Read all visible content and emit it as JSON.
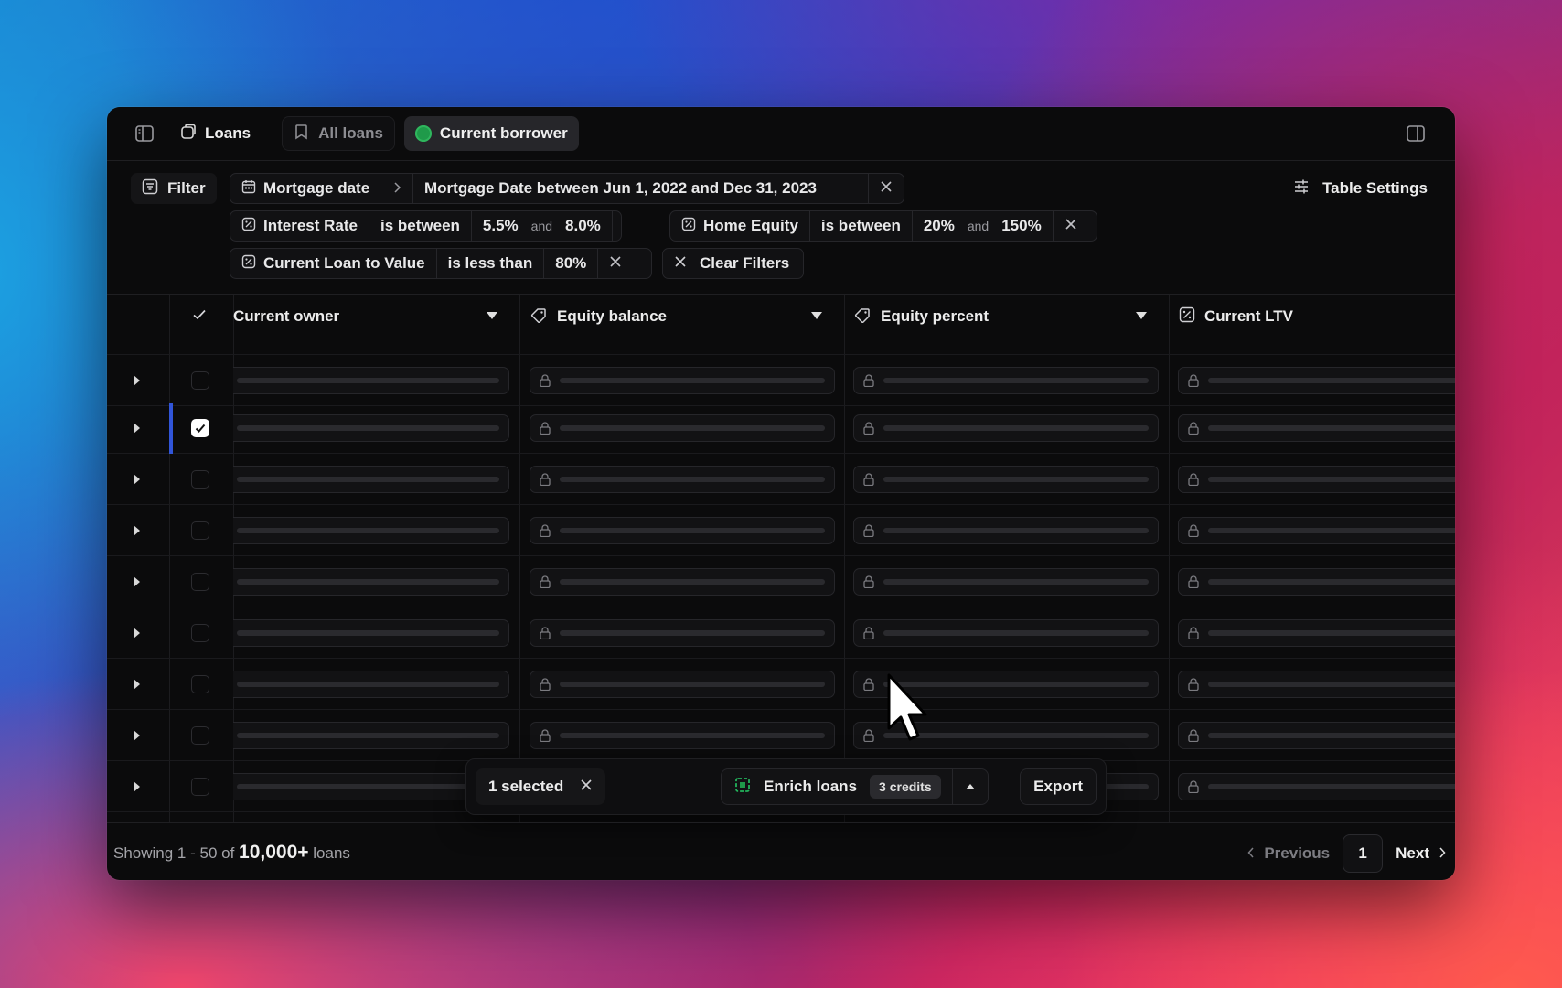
{
  "topbar": {
    "tabs": [
      {
        "label": "Loans",
        "icon": "loans-icon"
      },
      {
        "label": "All loans",
        "icon": "bookmark-icon"
      },
      {
        "label": "Current borrower",
        "icon": "green-dot-icon"
      }
    ]
  },
  "filters": {
    "filter_label": "Filter",
    "table_settings_label": "Table Settings",
    "mortgage": {
      "field": "Mortgage date",
      "value": "Mortgage Date between Jun 1, 2022 and Dec 31, 2023"
    },
    "interest": {
      "field": "Interest Rate",
      "operator": "is between",
      "min": "5.5%",
      "and": "and",
      "max": "8.0%"
    },
    "equity": {
      "field": "Home Equity",
      "operator": "is between",
      "min": "20%",
      "and": "and",
      "max": "150%"
    },
    "ltv": {
      "field": "Current Loan to Value",
      "operator": "is less than",
      "value": "80%"
    },
    "clear_label": "Clear Filters"
  },
  "table": {
    "columns": [
      {
        "label": "Current owner"
      },
      {
        "label": "Equity balance"
      },
      {
        "label": "Equity percent"
      },
      {
        "label": "Current LTV"
      }
    ],
    "selected_row_index": 1
  },
  "actionbar": {
    "selected_text": "1 selected",
    "enrich_label": "Enrich loans",
    "credits_label": "3 credits",
    "export_label": "Export"
  },
  "footer": {
    "showing_prefix": "Showing 1 - 50 of",
    "total": "10,000+",
    "suffix": "loans",
    "previous_label": "Previous",
    "page": "1",
    "next_label": "Next"
  },
  "colors": {
    "accent_selected": "#3155d9",
    "status_green": "#1f9a4a"
  }
}
